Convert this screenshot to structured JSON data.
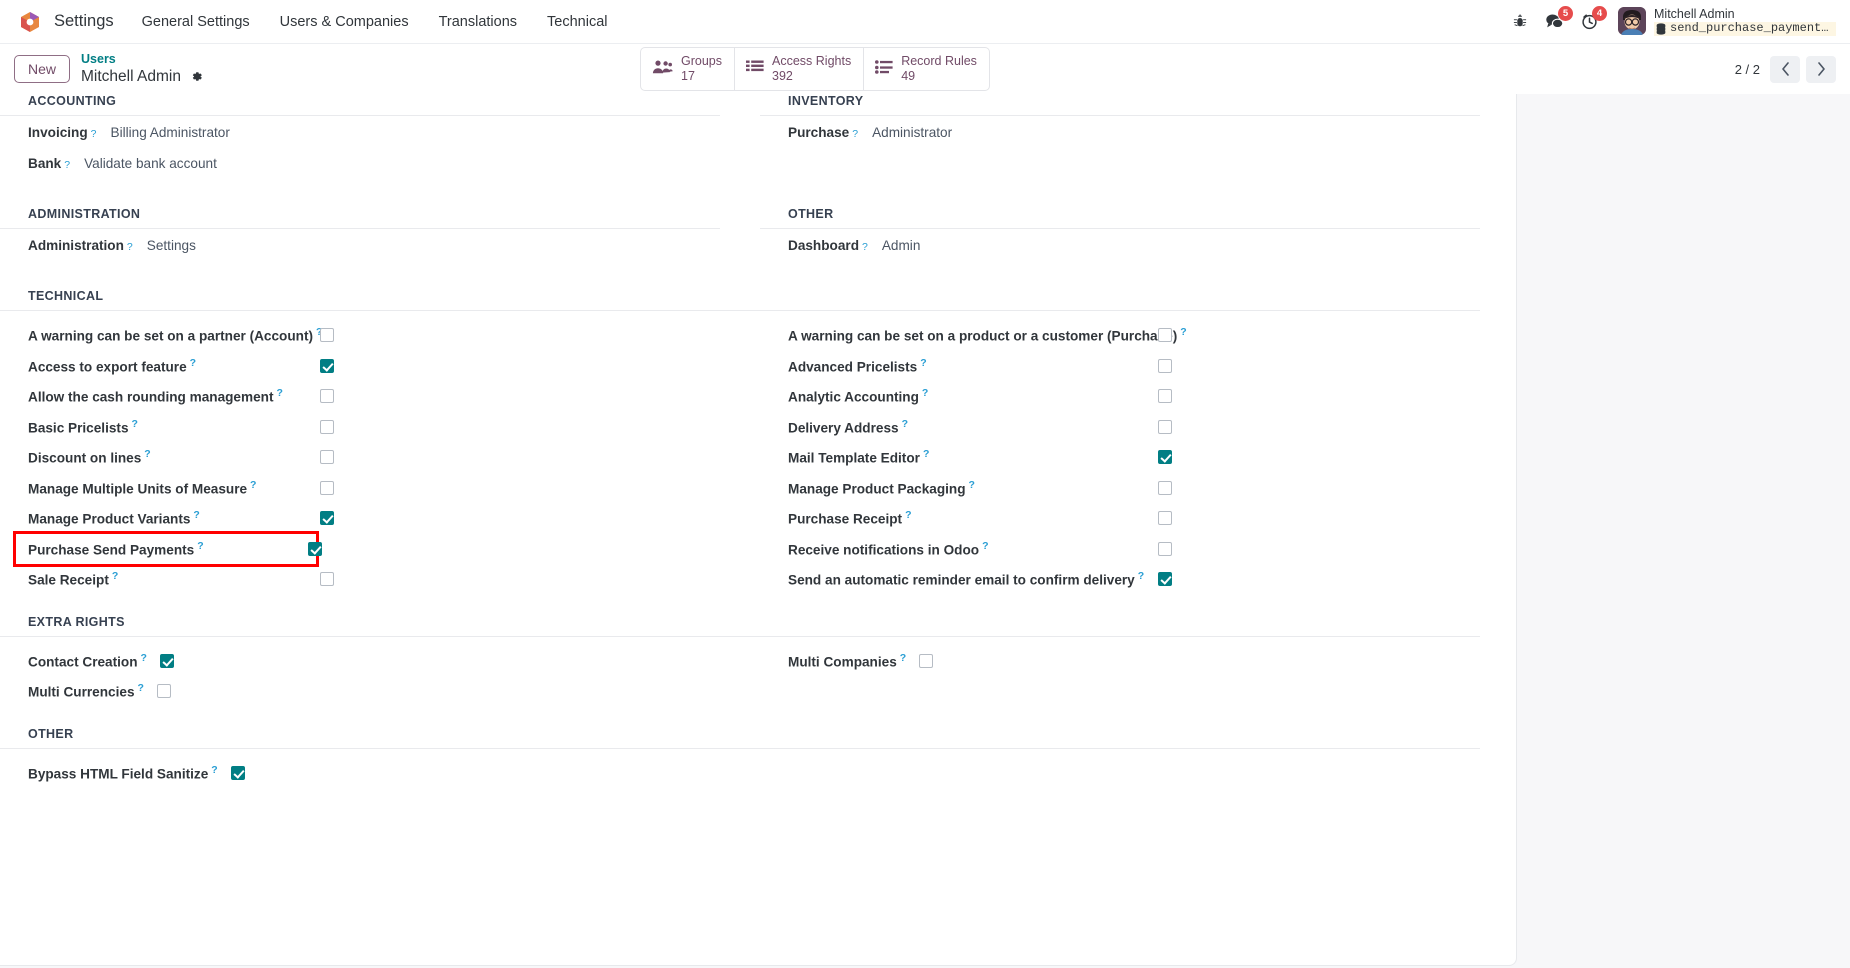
{
  "navbar": {
    "brand": "Settings",
    "menu": [
      {
        "label": "General Settings"
      },
      {
        "label": "Users & Companies"
      },
      {
        "label": "Translations"
      },
      {
        "label": "Technical"
      }
    ],
    "icons": {
      "debug": "bug-icon",
      "messages": "chat-icon",
      "activities": "clock-icon"
    },
    "messages_count": "5",
    "activities_count": "4",
    "user_name": "Mitchell Admin",
    "database_name": "send_purchase_payment_kn…"
  },
  "control_panel": {
    "new_label": "New",
    "breadcrumb_parent": "Users",
    "breadcrumb_current": "Mitchell Admin",
    "stat_buttons": [
      {
        "label": "Groups",
        "value": "17",
        "icon": "users-icon"
      },
      {
        "label": "Access Rights",
        "value": "392",
        "icon": "list-icon"
      },
      {
        "label": "Record Rules",
        "value": "49",
        "icon": "rules-icon"
      }
    ],
    "pager": {
      "count": "2 / 2",
      "prev": "‹",
      "next": "›"
    }
  },
  "sections": {
    "accounting": {
      "title": "ACCOUNTING",
      "fields": [
        {
          "label": "Invoicing",
          "value": "Billing Administrator"
        },
        {
          "label": "Bank",
          "value": "Validate bank account"
        }
      ]
    },
    "inventory": {
      "title": "INVENTORY",
      "fields": [
        {
          "label": "Purchase",
          "value": "Administrator"
        }
      ]
    },
    "administration": {
      "title": "ADMINISTRATION",
      "fields": [
        {
          "label": "Administration",
          "value": "Settings"
        }
      ]
    },
    "other_top": {
      "title": "OTHER",
      "fields": [
        {
          "label": "Dashboard",
          "value": "Admin"
        }
      ]
    },
    "technical": {
      "title": "TECHNICAL",
      "left": [
        {
          "label": "A warning can be set on a partner (Account)",
          "checked": false
        },
        {
          "label": "Access to export feature",
          "checked": true
        },
        {
          "label": "Allow the cash rounding management",
          "checked": false
        },
        {
          "label": "Basic Pricelists",
          "checked": false
        },
        {
          "label": "Discount on lines",
          "checked": false
        },
        {
          "label": "Manage Multiple Units of Measure",
          "checked": false
        },
        {
          "label": "Manage Product Variants",
          "checked": true
        },
        {
          "label": "Purchase Send Payments",
          "checked": true,
          "highlighted": true
        },
        {
          "label": "Sale Receipt",
          "checked": false
        }
      ],
      "right": [
        {
          "label": "A warning can be set on a product or a customer (Purchase)",
          "checked": false
        },
        {
          "label": "Advanced Pricelists",
          "checked": false
        },
        {
          "label": "Analytic Accounting",
          "checked": false
        },
        {
          "label": "Delivery Address",
          "checked": false
        },
        {
          "label": "Mail Template Editor",
          "checked": true
        },
        {
          "label": "Manage Product Packaging",
          "checked": false
        },
        {
          "label": "Purchase Receipt",
          "checked": false
        },
        {
          "label": "Receive notifications in Odoo",
          "checked": false
        },
        {
          "label": "Send an automatic reminder email to confirm delivery",
          "checked": true
        }
      ]
    },
    "extra_rights": {
      "title": "EXTRA RIGHTS",
      "left": [
        {
          "label": "Contact Creation",
          "checked": true
        },
        {
          "label": "Multi Currencies",
          "checked": false
        }
      ],
      "right": [
        {
          "label": "Multi Companies",
          "checked": false
        }
      ]
    },
    "other_bottom": {
      "title": "OTHER",
      "left": [
        {
          "label": "Bypass HTML Field Sanitize",
          "checked": true
        }
      ],
      "right": []
    }
  },
  "colors": {
    "accent": "#714b67",
    "checkbox_checked": "#017e84",
    "link": "#017e84",
    "highlight": "#ff0000",
    "badge": "#e64c4c"
  }
}
